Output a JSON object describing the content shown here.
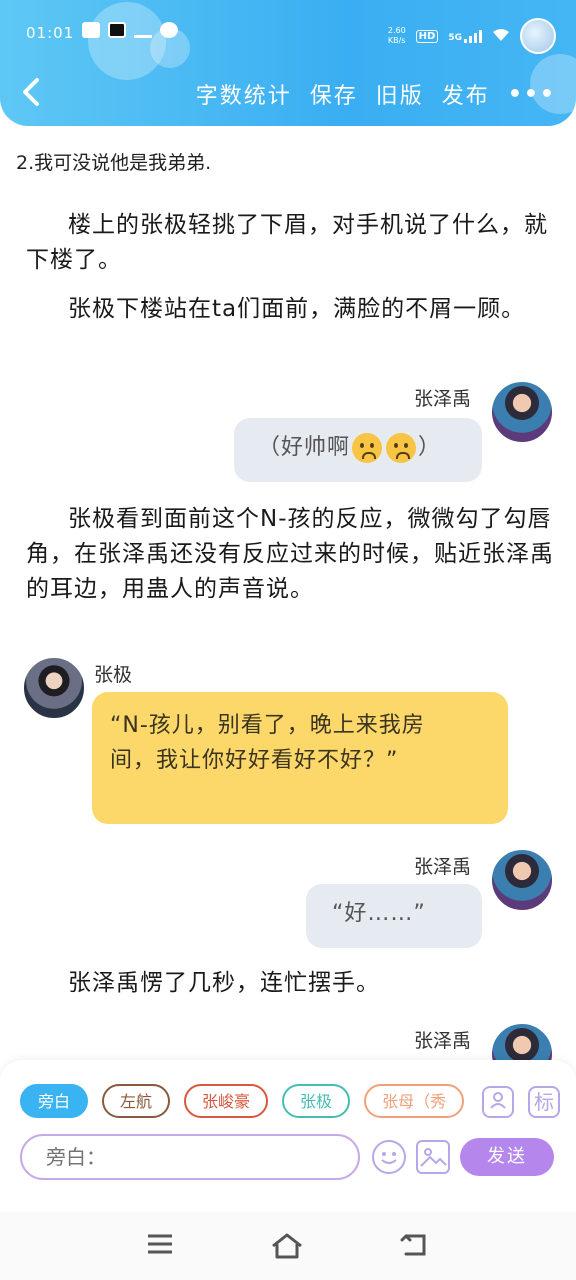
{
  "status": {
    "time": "01:01",
    "net_speed": "2.60\nKB/s",
    "hd": "HD",
    "net": "5G"
  },
  "toolbar": {
    "back_icon": "chevron-left-icon",
    "word_count": "字数统计",
    "save": "保存",
    "old_version": "旧版",
    "publish": "发布",
    "more": "•••"
  },
  "content": {
    "chapter_line": "2.我可没说他是我弟弟.",
    "p1": "楼上的张极轻挑了下眉，对手机说了什么，就下楼了。",
    "p2": "张极下楼站在ta们面前，满脸的不屑一顾。",
    "msg1": {
      "speaker": "张泽禹",
      "text_a": "（好帅啊",
      "text_b": "）"
    },
    "p3": "张极看到面前这个N-孩的反应，微微勾了勾唇角，在张泽禹还没有反应过来的时候，贴近张泽禹的耳边，用蛊人的声音说。",
    "msg2": {
      "speaker": "张极",
      "text": "“N-孩儿，别看了，晚上来我房间，我让你好好看好不好？”"
    },
    "msg3": {
      "speaker": "张泽禹",
      "text": "“好……”"
    },
    "p4": "张泽禹愣了几秒，连忙摆手。",
    "msg4": {
      "speaker": "张泽禹"
    }
  },
  "panel": {
    "chips": [
      "旁白",
      "左航",
      "张峻豪",
      "张极",
      "张母（秀"
    ],
    "input_placeholder": "旁白：",
    "send": "发送",
    "tag_icon_text": "标"
  },
  "colors": {
    "header": "#3aaef2",
    "accent_purple": "#b587ec",
    "yellow_bubble": "#fcd86a",
    "gray_bubble": "#e6eaf1"
  }
}
